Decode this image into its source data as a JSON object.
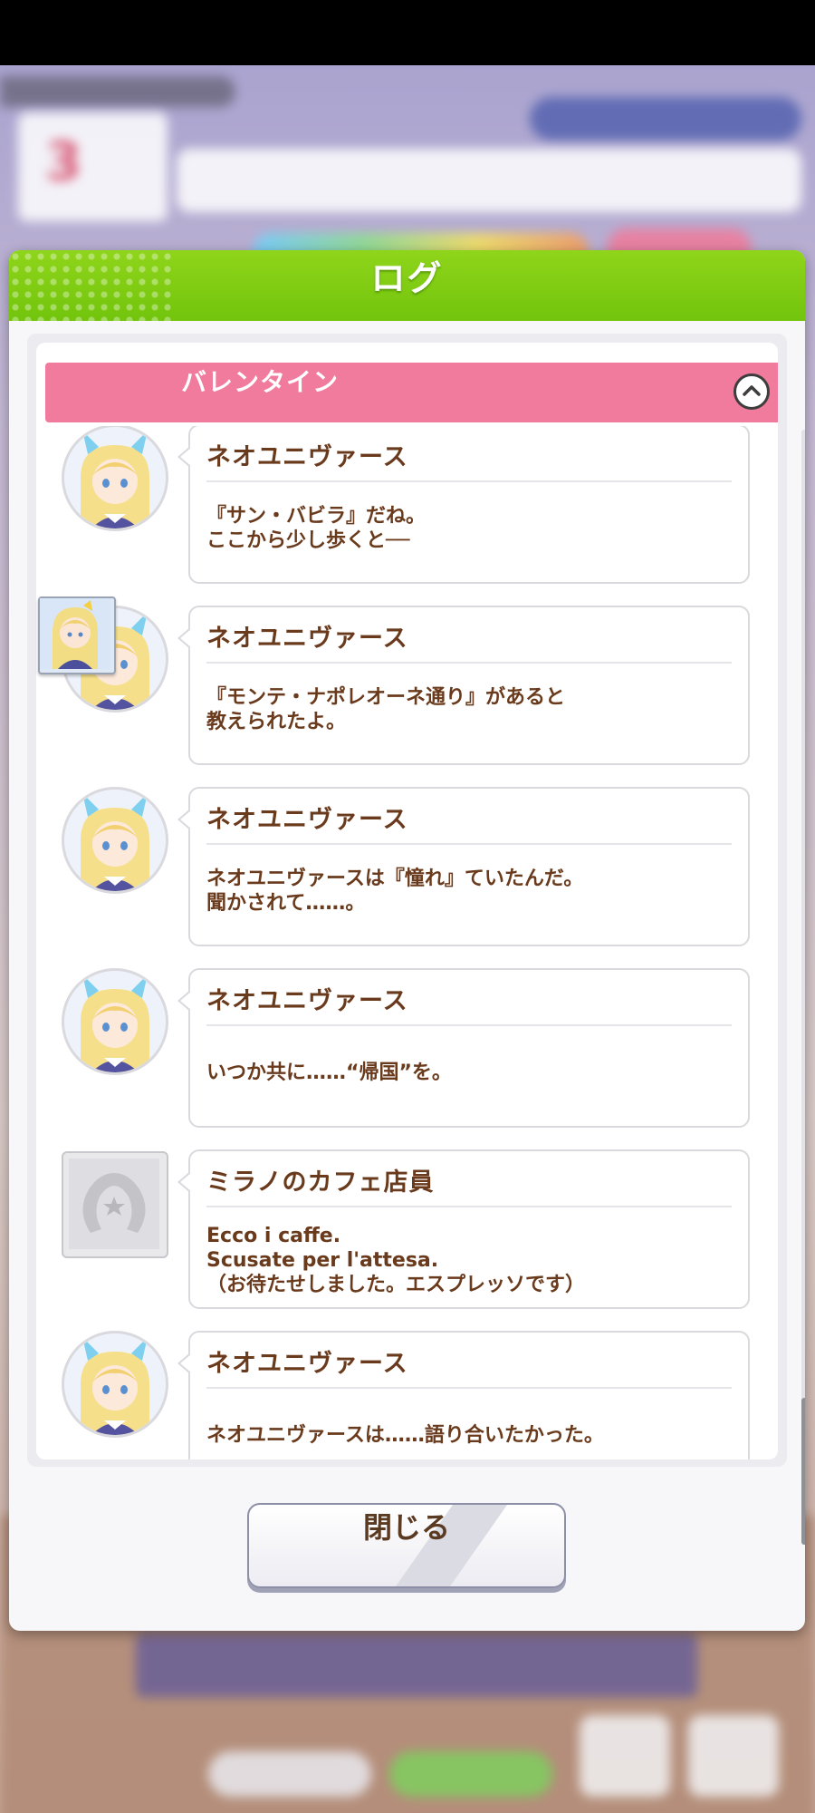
{
  "dialog": {
    "title": "ログ",
    "chapter": "バレンタイン",
    "close_label": "閉じる"
  },
  "background": {
    "turn_number": "3"
  },
  "entries": [
    {
      "speaker": "ネオユニヴァース",
      "lines": [
        "『サン・バビラ』だね。",
        "ここから少し歩くと──"
      ],
      "avatar": "neo-universe"
    },
    {
      "speaker": "ネオユニヴァース",
      "lines": [
        "『モンテ・ナポレオーネ通り』があると",
        "教えられたよ。"
      ],
      "avatar": "neo-universe"
    },
    {
      "speaker": "ネオユニヴァース",
      "lines": [
        "ネオユニヴァースは『憧れ』ていたんだ。",
        "聞かされて……。"
      ],
      "avatar": "neo-universe"
    },
    {
      "speaker": "ネオユニヴァース",
      "lines": [
        "いつか共に……“帰国”を。"
      ],
      "avatar": "neo-universe"
    },
    {
      "speaker": "ミラノのカフェ店員",
      "lines": [
        "Ecco i caffe.",
        "Scusate per l'attesa.",
        "（お待たせしました。エスプレッソです）"
      ],
      "avatar": "placeholder"
    },
    {
      "speaker": "ネオユニヴァース",
      "lines": [
        "ネオユニヴァースは……語り合いたかった。"
      ],
      "avatar": "neo-universe"
    }
  ],
  "colors": {
    "header": "#7ac90f",
    "chapter_bar": "#f17b9d",
    "text": "#6a3a1c"
  }
}
